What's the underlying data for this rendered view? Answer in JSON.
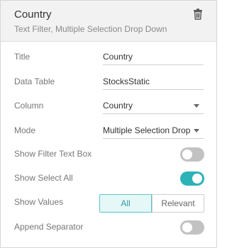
{
  "header": {
    "title": "Country",
    "subtitle": "Text Filter, Multiple Selection Drop Down",
    "delete_icon": "trash-icon"
  },
  "fields": {
    "title": {
      "label": "Title",
      "value": "Country"
    },
    "data_table": {
      "label": "Data Table",
      "value": "StocksStatic"
    },
    "column": {
      "label": "Column",
      "value": "Country"
    },
    "mode": {
      "label": "Mode",
      "value": "Multiple Selection Drop"
    },
    "show_filter_text_box": {
      "label": "Show Filter Text Box",
      "state": "off"
    },
    "show_select_all": {
      "label": "Show Select All",
      "state": "on"
    },
    "show_values": {
      "label": "Show Values",
      "options": [
        "All",
        "Relevant"
      ],
      "selected": "All"
    },
    "append_separator": {
      "label": "Append Separator",
      "state": "off"
    }
  },
  "colors": {
    "accent": "#2bb3b8",
    "toggle_off": "#c2c2c2",
    "header_bg": "#f2f2f2"
  }
}
